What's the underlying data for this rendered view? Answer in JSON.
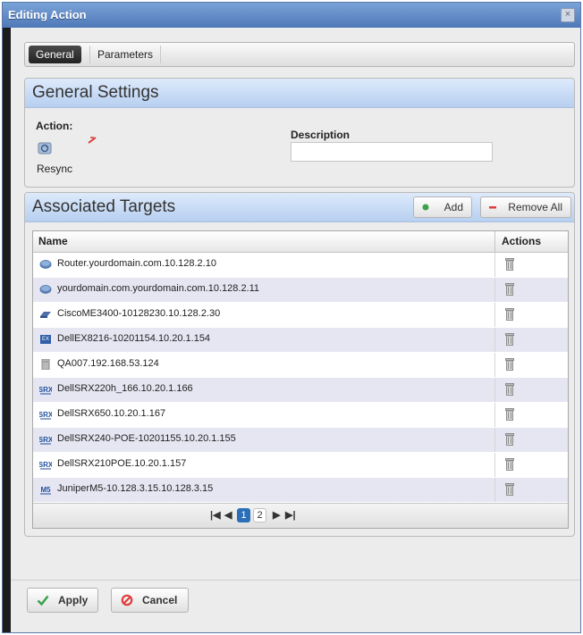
{
  "window": {
    "title": "Editing Action",
    "close_glyph": "×"
  },
  "tabs": [
    {
      "label": "General",
      "active": true
    },
    {
      "label": "Parameters",
      "active": false
    }
  ],
  "general_settings": {
    "title": "General Settings",
    "action_label": "Action:",
    "action_value": "Resync",
    "description_label": "Description",
    "description_value": ""
  },
  "associated_targets": {
    "title": "Associated Targets",
    "add_label": "Add",
    "remove_all_label": "Remove All",
    "columns": {
      "name": "Name",
      "actions": "Actions"
    },
    "rows": [
      {
        "name": "Router.yourdomain.com.10.128.2.10",
        "icon": "router-icon"
      },
      {
        "name": "yourdomain.com.yourdomain.com.10.128.2.11",
        "icon": "router-icon"
      },
      {
        "name": "CiscoME3400-10128230.10.128.2.30",
        "icon": "switch-icon"
      },
      {
        "name": "DellEX8216-10201154.10.20.1.154",
        "icon": "ex-switch-icon"
      },
      {
        "name": "QA007.192.168.53.124",
        "icon": "server-icon"
      },
      {
        "name": "DellSRX220h_166.10.20.1.166",
        "icon": "srx-icon"
      },
      {
        "name": "DellSRX650.10.20.1.167",
        "icon": "srx-icon"
      },
      {
        "name": "DellSRX240-POE-10201155.10.20.1.155",
        "icon": "srx-icon"
      },
      {
        "name": "DellSRX210POE.10.20.1.157",
        "icon": "srx-icon"
      },
      {
        "name": "JuniperM5-10.128.3.15.10.128.3.15",
        "icon": "m5-icon"
      }
    ],
    "pager": {
      "first": "◀",
      "prev": "◀",
      "page1": "1",
      "page2": "2",
      "next": "▶",
      "last": "▶",
      "current_page": 1,
      "total_pages": 2
    }
  },
  "footer": {
    "apply_label": "Apply",
    "cancel_label": "Cancel"
  },
  "colors": {
    "title_bar": "#5a84c3",
    "panel_header": "#c7daf5",
    "row_alt": "#e6e6f3",
    "active_tab": "#2e2e2e",
    "page_active": "#2a6fb7"
  }
}
